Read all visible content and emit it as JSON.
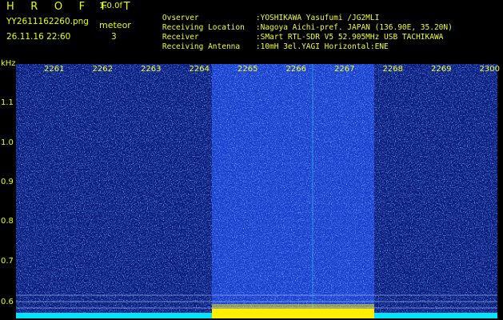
{
  "header": {
    "app_title": "H R O F F T",
    "app_version": "1.0.0f",
    "file_name": "YY2611162260.png",
    "timestamp": "26.11.16 22:60",
    "mode_label": "meteor",
    "mode_count": "3"
  },
  "info": [
    {
      "key": "Ovserver",
      "value": ":YOSHIKAWA Yasufumi /JG2MLI"
    },
    {
      "key": "Receiving Location",
      "value": ":Nagoya Aichi-pref. JAPAN (136.90E, 35.20N)"
    },
    {
      "key": "Receiver",
      "value": ":SMart RTL-SDR V5 52.905MHz USB TACHIKAWA"
    },
    {
      "key": "Receiving Antenna",
      "value": ":10mH 3el.YAGI Horizontal:ENE"
    }
  ],
  "plot": {
    "unit_label": "kHz",
    "y_ticks": [
      "1.1",
      "1.0",
      "0.9",
      "0.8",
      "0.7",
      "0.6"
    ],
    "x_ticks": [
      "2261",
      "2262",
      "2263",
      "2264",
      "2265",
      "2266",
      "2267",
      "2268",
      "2269",
      "2300"
    ],
    "colors": {
      "background_noise": "#0a1a78",
      "noise_dot": "#2a5cff",
      "bright_dot": "#30e0ff",
      "meteor_band": "#1a3ccc",
      "baseline": "#00e5ff",
      "meteor_baseline": "#ffee00",
      "tick_text": "#e8ff00"
    }
  }
}
